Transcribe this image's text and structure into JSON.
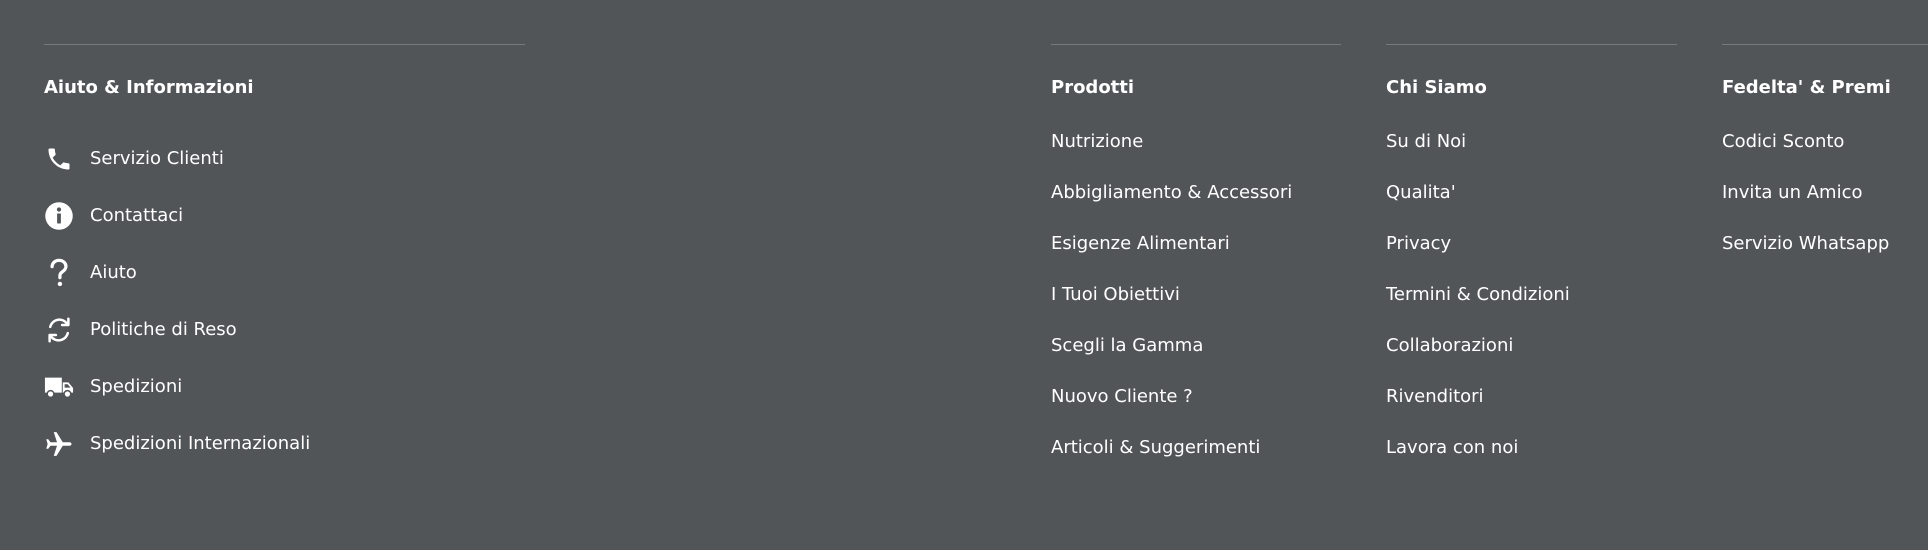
{
  "footer": {
    "help": {
      "title": "Aiuto & Informazioni",
      "items": [
        {
          "label": "Servizio Clienti",
          "icon": "phone-icon"
        },
        {
          "label": "Contattaci",
          "icon": "info-icon"
        },
        {
          "label": "Aiuto",
          "icon": "question-icon"
        },
        {
          "label": "Politiche di Reso",
          "icon": "refresh-icon"
        },
        {
          "label": "Spedizioni",
          "icon": "truck-icon"
        },
        {
          "label": "Spedizioni Internazionali",
          "icon": "airplane-icon"
        }
      ]
    },
    "products": {
      "title": "Prodotti",
      "items": [
        "Nutrizione",
        "Abbigliamento & Accessori",
        "Esigenze Alimentari",
        "I Tuoi Obiettivi",
        "Scegli la Gamma",
        "Nuovo Cliente ?",
        "Articoli & Suggerimenti"
      ]
    },
    "about": {
      "title": "Chi Siamo",
      "items": [
        "Su di Noi",
        "Qualita'",
        "Privacy",
        "Termini & Condizioni",
        "Collaborazioni",
        "Rivenditori",
        "Lavora con noi"
      ]
    },
    "loyalty": {
      "title": "Fedelta' & Premi",
      "items": [
        "Codici Sconto",
        "Invita un Amico",
        "Servizio Whatsapp"
      ]
    },
    "colors": {
      "background": "#515558",
      "text": "#ffffff"
    }
  }
}
